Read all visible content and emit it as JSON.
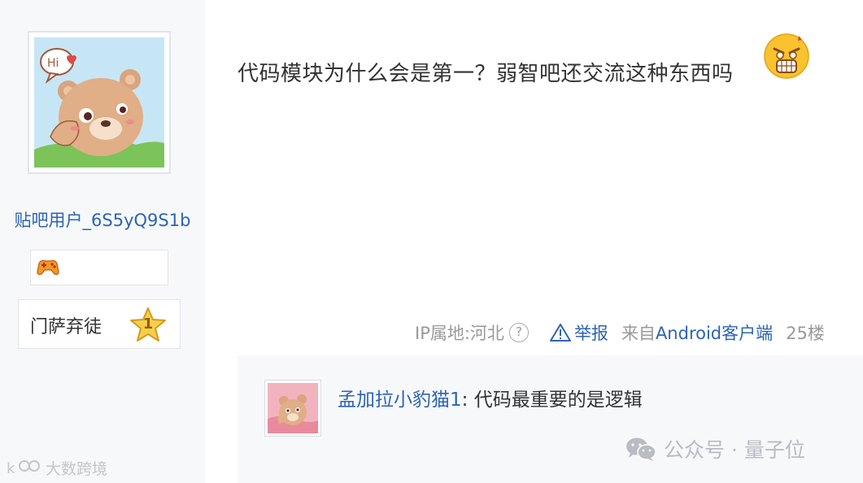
{
  "author": {
    "username": "贴吧用户_6S5yQ9S1b",
    "avatar": "bear-hi-avatar",
    "level_title": "门萨弃徒",
    "level": "1"
  },
  "post": {
    "text": "代码模块为什么会是第一？弱智吧还交流这种东西吗",
    "emoji": "angry-face-emoji"
  },
  "meta": {
    "ip_label": "IP属地:河北",
    "help_icon": "?",
    "report_label": "举报",
    "from_prefix": "来自",
    "client": "Android客户端",
    "floor": "25楼"
  },
  "reply": {
    "user": "孟加拉小豹猫1",
    "separator": ":",
    "content": "代码最重要的是逻辑",
    "avatar": "bear-reply-avatar"
  },
  "watermarks": {
    "right": "公众号 · 量子位",
    "left": "大数跨境"
  },
  "colors": {
    "link": "#2d64b3",
    "muted": "#999999",
    "sidebar_bg": "#f7f8fa"
  }
}
